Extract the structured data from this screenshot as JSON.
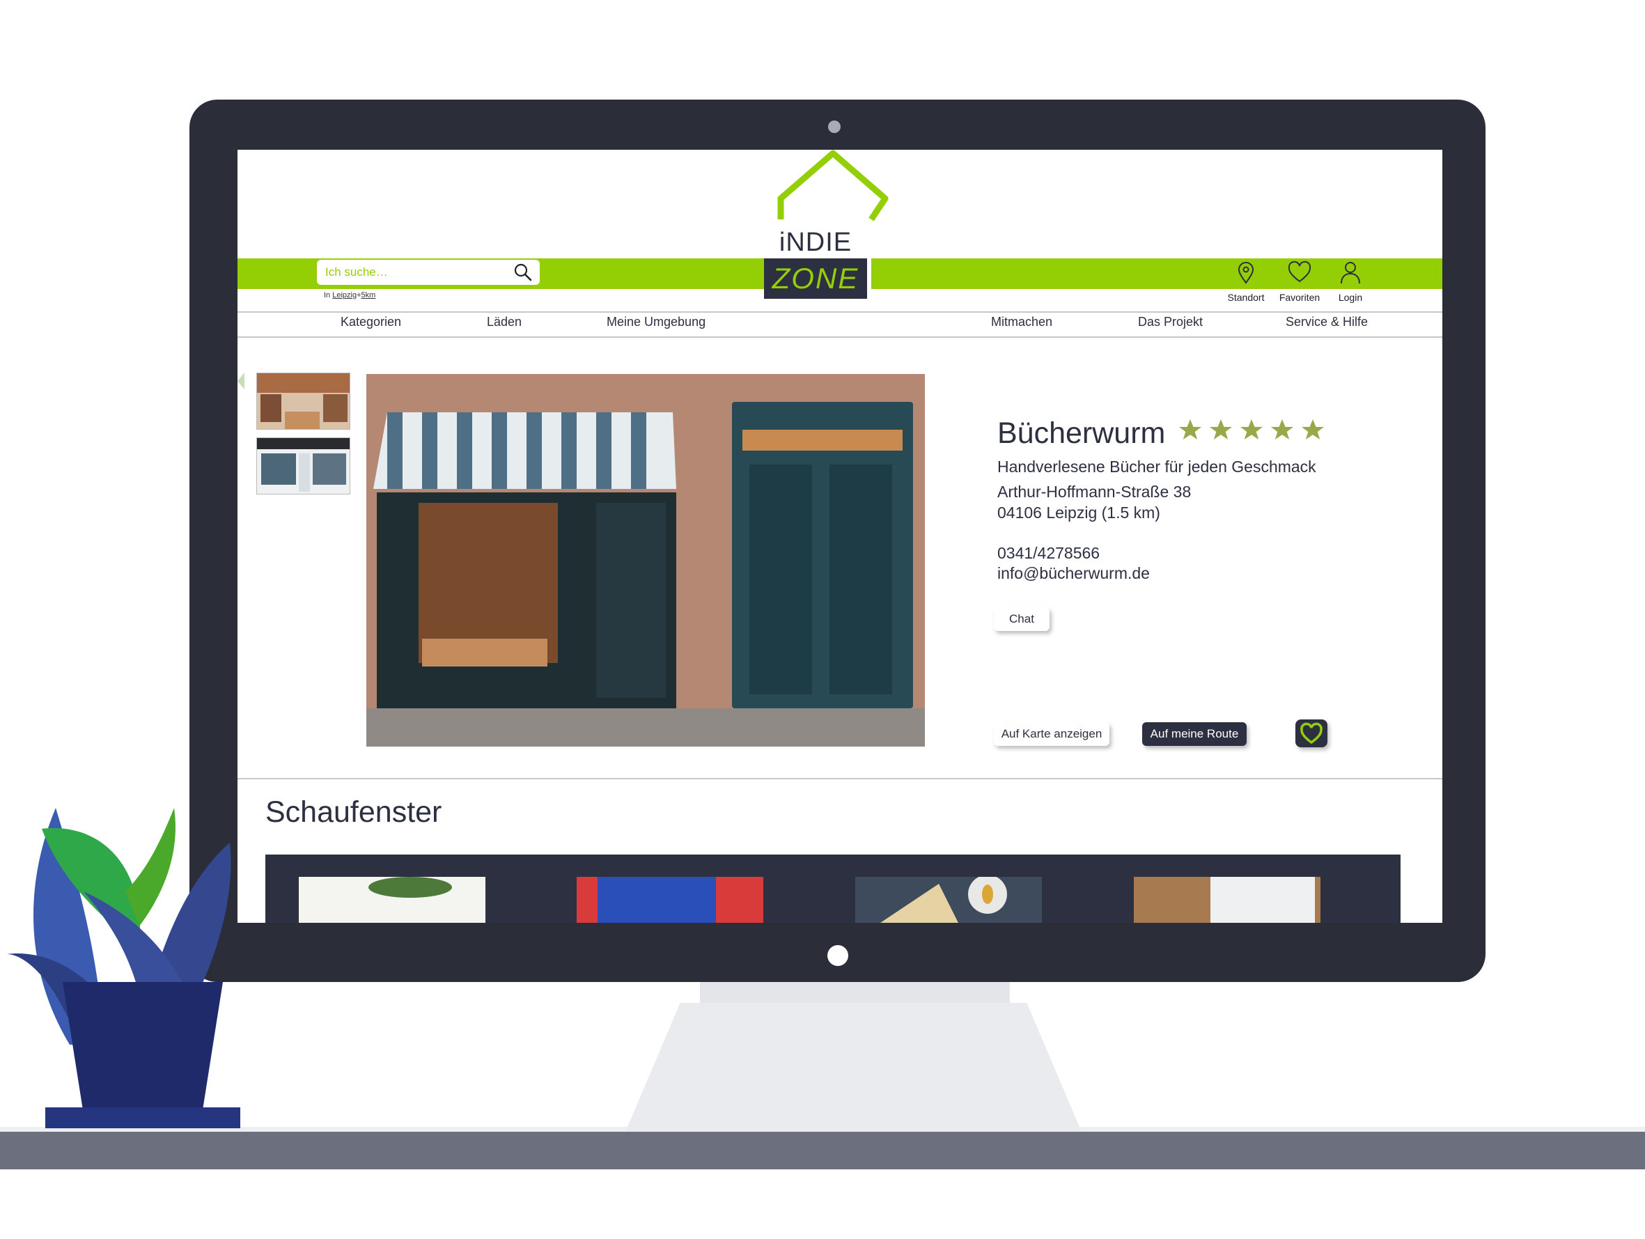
{
  "header": {
    "logo_top": "iNDIE",
    "logo_bottom": "ZONE",
    "search_placeholder": "Ich suche…",
    "location_prefix": "In",
    "location_city": "Leipzig",
    "location_sep": "+",
    "location_radius": "5km",
    "icons": [
      {
        "icon": "location-pin-icon",
        "label": "Standort"
      },
      {
        "icon": "heart-icon",
        "label": "Favoriten"
      },
      {
        "icon": "user-icon",
        "label": "Login"
      }
    ]
  },
  "nav": {
    "items": [
      "Kategorien",
      "Läden",
      "Meine Umgebung",
      "Mitmachen",
      "Das Projekt",
      "Service & Hilfe"
    ]
  },
  "shop": {
    "name": "Bücherwurm",
    "rating": 5,
    "tagline": "Handverlesene Bücher für jeden Geschmack",
    "street": "Arthur-Hoffmann-Straße 38",
    "city": "04106 Leipzig (1.5 km)",
    "phone": "0341/4278566",
    "email": "info@bücherwurm.de",
    "chat_label": "Chat",
    "map_label": "Auf  Karte anzeigen",
    "route_label": "Auf meine Route"
  },
  "showcase": {
    "title": "Schaufenster"
  },
  "colors": {
    "brand_green": "#94cf05",
    "navy": "#2c3040",
    "star": "#9aa84a"
  }
}
